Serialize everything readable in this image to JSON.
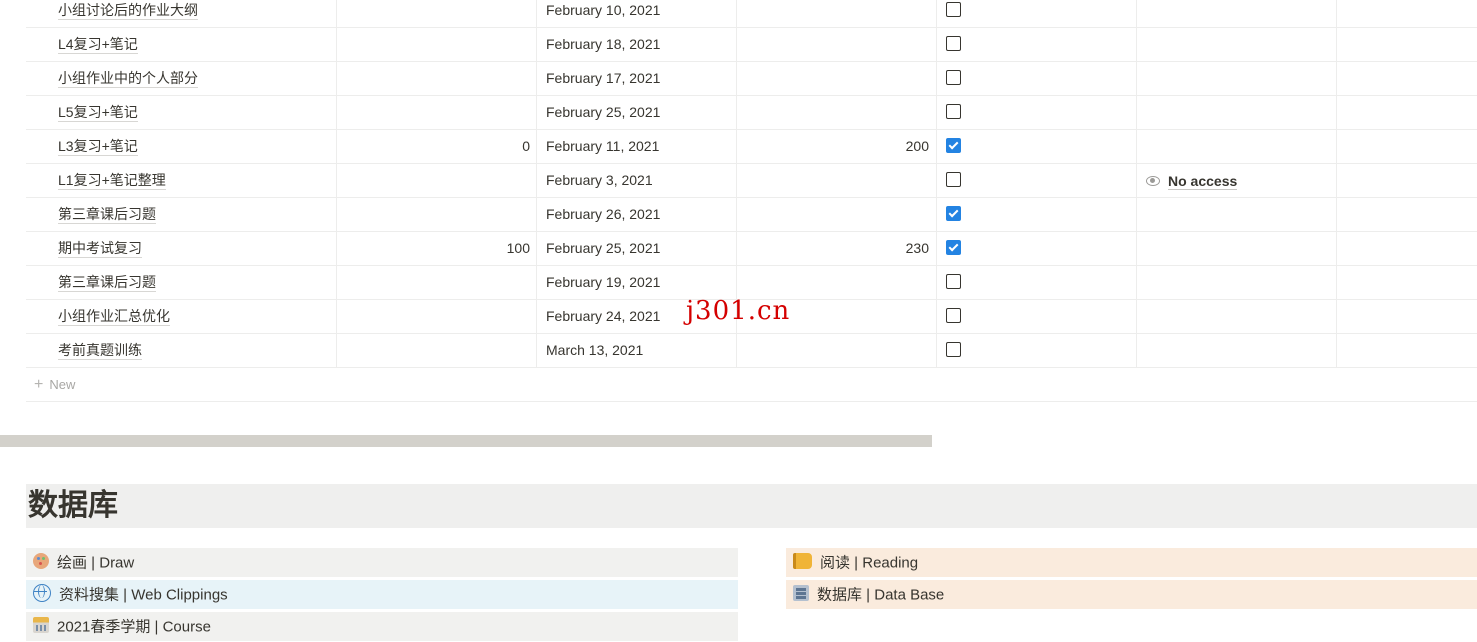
{
  "table": {
    "rows": [
      {
        "title": "小组讨论后的作业大纲",
        "num1": "",
        "date": "February 10, 2021",
        "num2": "",
        "checked": false,
        "access": ""
      },
      {
        "title": "L4复习+笔记",
        "num1": "",
        "date": "February 18, 2021",
        "num2": "",
        "checked": false,
        "access": ""
      },
      {
        "title": "小组作业中的个人部分",
        "num1": "",
        "date": "February 17, 2021",
        "num2": "",
        "checked": false,
        "access": ""
      },
      {
        "title": "L5复习+笔记",
        "num1": "",
        "date": "February 25, 2021",
        "num2": "",
        "checked": false,
        "access": ""
      },
      {
        "title": "L3复习+笔记",
        "num1": "0",
        "date": "February 11, 2021",
        "num2": "200",
        "checked": true,
        "access": ""
      },
      {
        "title": "L1复习+笔记整理",
        "num1": "",
        "date": "February 3, 2021",
        "num2": "",
        "checked": false,
        "access": "No access"
      },
      {
        "title": "第三章课后习题",
        "num1": "",
        "date": "February 26, 2021",
        "num2": "",
        "checked": true,
        "access": ""
      },
      {
        "title": "期中考试复习",
        "num1": "100",
        "date": "February 25, 2021",
        "num2": "230",
        "checked": true,
        "access": ""
      },
      {
        "title": "第三章课后习题",
        "num1": "",
        "date": "February 19, 2021",
        "num2": "",
        "checked": false,
        "access": ""
      },
      {
        "title": "小组作业汇总优化",
        "num1": "",
        "date": "February 24, 2021",
        "num2": "",
        "checked": false,
        "access": ""
      },
      {
        "title": "考前真题训练",
        "num1": "",
        "date": "March 13, 2021",
        "num2": "",
        "checked": false,
        "access": ""
      }
    ],
    "new_label": "New"
  },
  "watermark": "j301.cn",
  "section": {
    "title": "数据库"
  },
  "cards": {
    "left": [
      {
        "label": "绘画 | Draw",
        "icon": "palette-icon",
        "bg": "#f1f1ef"
      },
      {
        "label": "资料搜集 | Web Clippings",
        "icon": "globe-icon",
        "bg": "#e7f3f8"
      },
      {
        "label": "2021春季学期 | Course",
        "icon": "school-icon",
        "bg": "#f1f1ef"
      }
    ],
    "right": [
      {
        "label": "阅读 | Reading",
        "icon": "book-icon",
        "bg": "#faebdd"
      },
      {
        "label": "数据库 | Data Base",
        "icon": "database-icon",
        "bg": "#faebdd"
      }
    ]
  },
  "colors": {
    "checkbox_checked": "#2383e2",
    "watermark": "#d40000",
    "scrollbar": "#d3d1cb"
  }
}
